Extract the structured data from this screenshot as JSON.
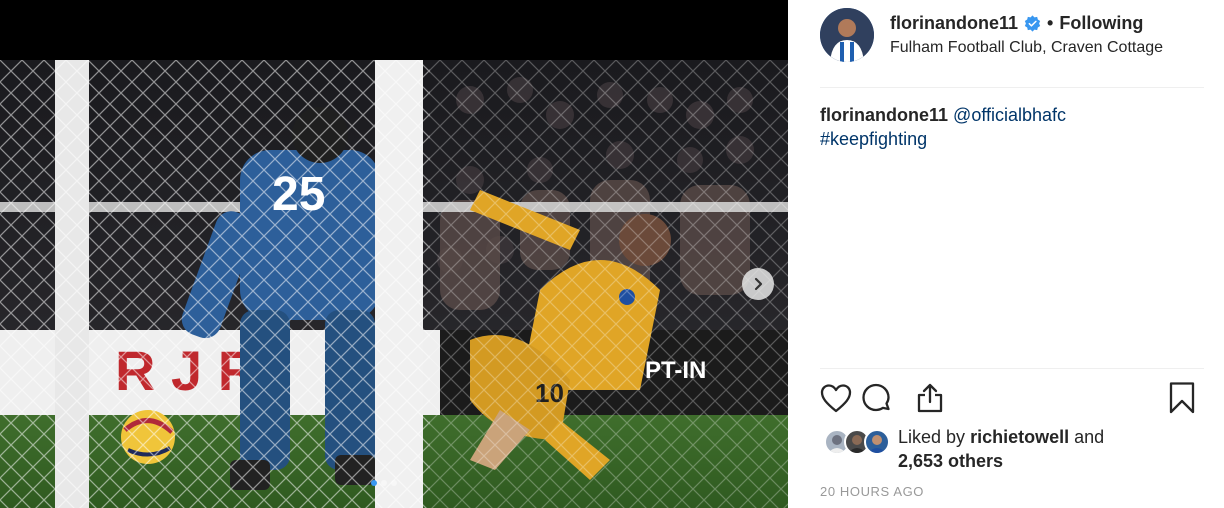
{
  "post": {
    "username": "florinandone11",
    "bullet": "•",
    "follow_label": "Following",
    "location": "Fulham Football Club, Craven Cottage",
    "caption": {
      "author": "florinandone11",
      "mention": "@officialbhafc",
      "hashtag": "#keepfighting"
    },
    "likes": {
      "prefix": "Liked by",
      "user": "richietowell",
      "conjunction": "and",
      "others": "2,653 others"
    },
    "timestamp": "20 HOURS AGO"
  },
  "media": {
    "jersey_number_keeper": "25",
    "jersey_number_player": "10",
    "carousel_total": 3,
    "carousel_active_index": 0
  },
  "colors": {
    "verified_blue": "#3897f0",
    "link_blue": "#003569",
    "muted_gray": "#999999",
    "brighton_yellow": "#e0a526",
    "keeper_blue": "#2d5f9a"
  },
  "icons": [
    "verified-badge-icon",
    "chevron-right-icon",
    "heart-icon",
    "comment-icon",
    "share-icon",
    "bookmark-icon"
  ]
}
